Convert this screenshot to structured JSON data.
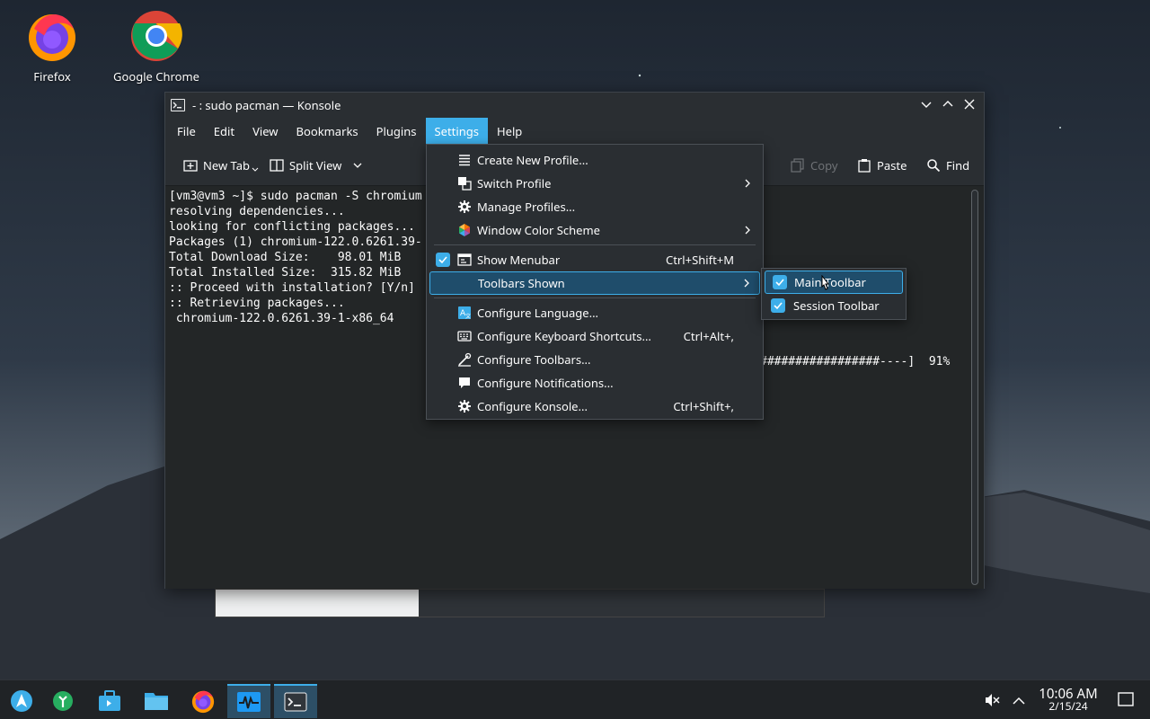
{
  "desktop": {
    "icons": [
      {
        "label": "Firefox"
      },
      {
        "label": "Google Chrome"
      }
    ]
  },
  "window": {
    "title": "- : sudo pacman — Konsole",
    "menubar": [
      "File",
      "Edit",
      "View",
      "Bookmarks",
      "Plugins",
      "Settings",
      "Help"
    ],
    "active_menu": "Settings",
    "toolbar": {
      "new_tab": "New Tab",
      "split_view": "Split View",
      "copy": "Copy",
      "paste": "Paste",
      "find": "Find"
    },
    "terminal": {
      "lines": [
        "[vm3@vm3 ~]$ sudo pacman -S chromium",
        "resolving dependencies...",
        "looking for conflicting packages...",
        "",
        "Packages (1) chromium-122.0.6261.39-",
        "",
        "Total Download Size:    98.01 MiB",
        "Total Installed Size:  315.82 MiB",
        "",
        ":: Proceed with installation? [Y/n]",
        ":: Retrieving packages...",
        " chromium-122.0.6261.39-1-x86_64"
      ],
      "progress_tail": "#################----]  91%"
    }
  },
  "settings_menu": {
    "items": [
      {
        "label": "Create New Profile...",
        "icon": "list-icon"
      },
      {
        "label": "Switch Profile",
        "icon": "switch-profile-icon",
        "submenu": true
      },
      {
        "label": "Manage Profiles...",
        "icon": "gear-icon"
      },
      {
        "label": "Window Color Scheme",
        "icon": "color-scheme-icon",
        "submenu": true
      },
      {
        "label": "Show Menubar",
        "icon": "menubar-icon",
        "shortcut": "Ctrl+Shift+M",
        "checked": true
      },
      {
        "label": "Toolbars Shown",
        "submenu": true,
        "highlighted": true
      },
      {
        "label": "Configure Language...",
        "icon": "language-icon"
      },
      {
        "label": "Configure Keyboard Shortcuts...",
        "icon": "keyboard-icon",
        "shortcut": "Ctrl+Alt+,"
      },
      {
        "label": "Configure Toolbars...",
        "icon": "configure-toolbars-icon"
      },
      {
        "label": "Configure Notifications...",
        "icon": "notification-icon"
      },
      {
        "label": "Configure Konsole...",
        "icon": "gear-icon",
        "shortcut": "Ctrl+Shift+,"
      }
    ]
  },
  "toolbars_submenu": {
    "items": [
      {
        "label": "Main Toolbar",
        "checked": true,
        "highlighted": true
      },
      {
        "label": "Session Toolbar",
        "checked": true
      }
    ]
  },
  "taskbar": {
    "clock_time": "10:06 AM",
    "clock_date": "2/15/24"
  },
  "colors": {
    "accent": "#3daee9",
    "window_bg": "#2a2e32",
    "terminal_bg": "#232627"
  }
}
